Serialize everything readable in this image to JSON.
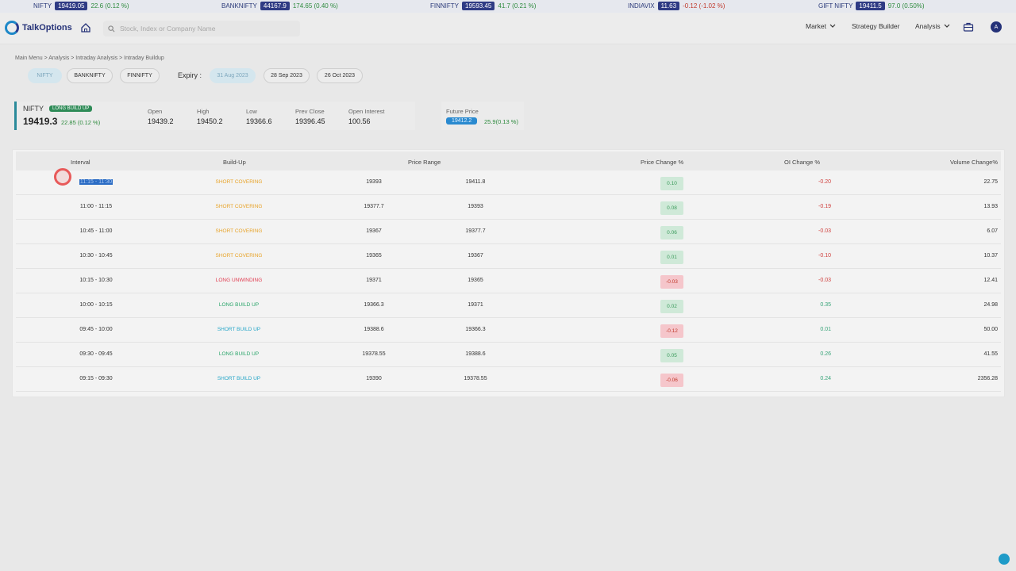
{
  "ticker": [
    {
      "symbol": "NIFTY",
      "price": "19419.05",
      "change": "22.6 (0.12 %)",
      "dir": "pos"
    },
    {
      "symbol": "BANKNIFTY",
      "price": "44167.9",
      "change": "174.65 (0.40 %)",
      "dir": "pos"
    },
    {
      "symbol": "FINNIFTY",
      "price": "19593.45",
      "change": "41.7 (0.21 %)",
      "dir": "pos"
    },
    {
      "symbol": "INDIAVIX",
      "price": "11.63",
      "change": "-0.12 (-1.02 %)",
      "dir": "neg"
    },
    {
      "symbol": "GIFT NIFTY",
      "price": "19411.5",
      "change": "97.0 (0.50%)",
      "dir": "pos"
    }
  ],
  "header": {
    "logo_text": "TalkOptions",
    "search_placeholder": "Stock, Index or Company Name",
    "nav": {
      "market": "Market",
      "strategy_builder": "Strategy Builder",
      "analysis": "Analysis"
    },
    "avatar_initial": "A"
  },
  "breadcrumb": "Main Menu > Analysis > Intraday Analysis > Intraday Buildup",
  "filters": {
    "symbols": [
      "NIFTY",
      "BANKNIFTY",
      "FINNIFTY"
    ],
    "expiry_label": "Expiry :",
    "expiries": [
      "31 Aug 2023",
      "28 Sep 2023",
      "26 Oct 2023"
    ]
  },
  "summary": {
    "name": "NIFTY",
    "badge": "LONG BUILD UP",
    "price": "19419.3",
    "change": "22.85 (0.12 %)",
    "stats": [
      {
        "label": "Open",
        "value": "19439.2"
      },
      {
        "label": "High",
        "value": "19450.2"
      },
      {
        "label": "Low",
        "value": "19366.6"
      },
      {
        "label": "Prev Close",
        "value": "19396.45"
      },
      {
        "label": "Open Interest",
        "value": "100.56"
      }
    ],
    "future_label": "Future Price",
    "future_price": "19412.2",
    "future_change": "25.9(0.13 %)"
  },
  "table": {
    "headers": {
      "interval": "Interval",
      "buildup": "Build-Up",
      "price_range": "Price Range",
      "price_change": "Price Change %",
      "oi_change": "OI Change %",
      "volume_change": "Volume Change%"
    },
    "rows": [
      {
        "interval": "11:15 - 11:30",
        "buildup": "SHORT COVERING",
        "low": "19393",
        "high": "19411.8",
        "price_change": "0.10",
        "oi_change": "-0.20",
        "volume_change": "22.75"
      },
      {
        "interval": "11:00 - 11:15",
        "buildup": "SHORT COVERING",
        "low": "19377.7",
        "high": "19393",
        "price_change": "0.08",
        "oi_change": "-0.19",
        "volume_change": "13.93"
      },
      {
        "interval": "10:45 - 11:00",
        "buildup": "SHORT COVERING",
        "low": "19367",
        "high": "19377.7",
        "price_change": "0.06",
        "oi_change": "-0.03",
        "volume_change": "6.07"
      },
      {
        "interval": "10:30 - 10:45",
        "buildup": "SHORT COVERING",
        "low": "19365",
        "high": "19367",
        "price_change": "0.01",
        "oi_change": "-0.10",
        "volume_change": "10.37"
      },
      {
        "interval": "10:15 - 10:30",
        "buildup": "LONG UNWINDING",
        "low": "19371",
        "high": "19365",
        "price_change": "-0.03",
        "oi_change": "-0.03",
        "volume_change": "12.41"
      },
      {
        "interval": "10:00 - 10:15",
        "buildup": "LONG BUILD UP",
        "low": "19366.3",
        "high": "19371",
        "price_change": "0.02",
        "oi_change": "0.35",
        "volume_change": "24.98"
      },
      {
        "interval": "09:45 - 10:00",
        "buildup": "SHORT BUILD UP",
        "low": "19388.6",
        "high": "19366.3",
        "price_change": "-0.12",
        "oi_change": "0.01",
        "volume_change": "50.00"
      },
      {
        "interval": "09:30 - 09:45",
        "buildup": "LONG BUILD UP",
        "low": "19378.55",
        "high": "19388.6",
        "price_change": "0.05",
        "oi_change": "0.26",
        "volume_change": "41.55"
      },
      {
        "interval": "09:15 - 09:30",
        "buildup": "SHORT BUILD UP",
        "low": "19390",
        "high": "19378.55",
        "price_change": "-0.06",
        "oi_change": "0.24",
        "volume_change": "2356.28"
      }
    ]
  },
  "colors": {
    "brand": "#253278",
    "accent": "#1e88c8",
    "positive": "#2e8b3e",
    "negative": "#c0392b"
  }
}
